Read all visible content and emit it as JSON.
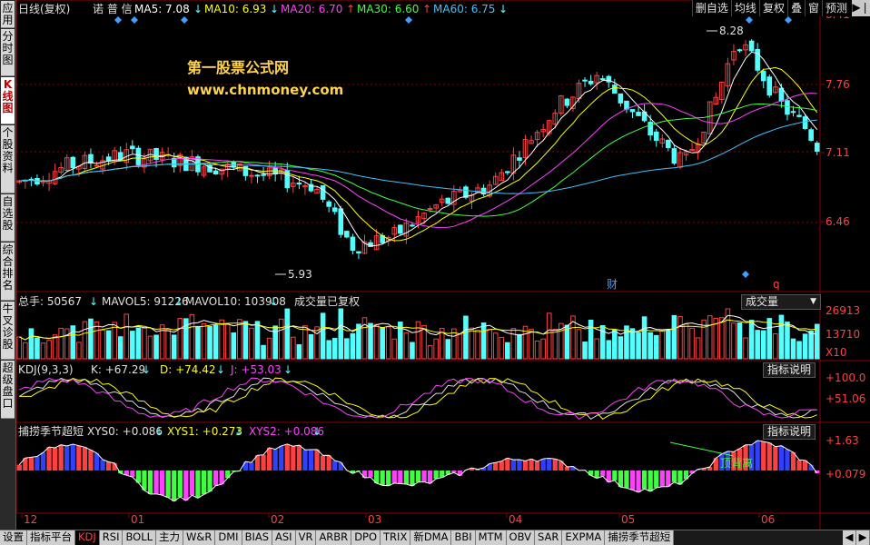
{
  "sidebar": {
    "items": [
      {
        "label": "应用",
        "active": false
      },
      {
        "label": "分时图",
        "active": false
      },
      {
        "label": "K线图",
        "active": true
      },
      {
        "label": "个股资料",
        "active": false
      },
      {
        "label": "自选股",
        "active": false
      },
      {
        "label": "综合排名",
        "active": false
      },
      {
        "label": "牛叉诊股",
        "active": false
      },
      {
        "label": "超级盘口",
        "active": false
      }
    ]
  },
  "header": {
    "period": "日线(复权)",
    "stock": "诺 普 信",
    "ma": [
      {
        "label": "MA5: 7.08",
        "arrow": "↓",
        "color": "#ffffff"
      },
      {
        "label": "MA10: 6.93",
        "arrow": "↓",
        "color": "#ffff00"
      },
      {
        "label": "MA20: 6.70",
        "arrow": "↑",
        "color": "#ff40ff"
      },
      {
        "label": "MA30: 6.60",
        "arrow": "↑",
        "color": "#40ff40"
      },
      {
        "label": "MA60: 6.75",
        "arrow": "↓",
        "color": "#40c0ff"
      }
    ]
  },
  "toolbar": {
    "items": [
      "删自选",
      "均线",
      "复权",
      "叠",
      "窗",
      "预测"
    ],
    "arrow": "▶❘"
  },
  "watermark": {
    "line1": "第一股票公式网",
    "line2": "www.chnmoney.com"
  },
  "price_axis": {
    "labels": [
      "8.41",
      "7.76",
      "7.11",
      "6.46"
    ],
    "high_mark": "8.28",
    "low_mark": "5.93"
  },
  "markers": {
    "cai": "财",
    "q": "q"
  },
  "volume_panel": {
    "title": "总手: 50567",
    "mavol5": "MAVOL5: 91226",
    "mavol10": "MAVOL10: 103908",
    "note": "成交量已复权",
    "selector": "成交量",
    "axis": [
      "26913",
      "13710",
      "X10"
    ]
  },
  "kdj_panel": {
    "title": "KDJ(9,3,3)",
    "k": "K: +67.29",
    "d": "D: +74.42",
    "j": "J: +53.03",
    "button": "指标说明",
    "axis": [
      "+100.0",
      "+51.06"
    ]
  },
  "custom_panel": {
    "title": "捕捞季节超短",
    "xys0": "XYS0: +0.086",
    "xys1": "XYS1: +0.273",
    "xys2": "XYS2: +0.086",
    "button": "指标说明",
    "axis": [
      "+1.63",
      "+0.079"
    ],
    "annotation": "顶背离"
  },
  "x_axis": {
    "labels": [
      "12",
      "01",
      "02",
      "03",
      "04",
      "05",
      "06"
    ]
  },
  "bottom_tabs": [
    "设置",
    "指标平台",
    "KDJ",
    "RSI",
    "BOLL",
    "主力",
    "W&R",
    "DMI",
    "BIAS",
    "ASI",
    "VR",
    "ARBR",
    "DPO",
    "TRIX",
    "新DMA",
    "BBI",
    "MTM",
    "OBV",
    "SAR",
    "EXPMA",
    "捕捞季节超短"
  ],
  "bottom_active": "KDJ",
  "bottom_nav": [
    "◀",
    "▶"
  ],
  "colors": {
    "up": "#ff4040",
    "down": "#54ffff",
    "ma5": "#ffffff",
    "ma10": "#ffff00",
    "ma20": "#ff40ff",
    "ma30": "#40ff40",
    "ma60": "#40c0ff",
    "grid": "#8b0000",
    "watermark": "#ffd24a"
  },
  "chart_data": {
    "type": "candlestick",
    "price_axis_ticks": [
      8.41,
      7.76,
      7.11,
      6.46
    ],
    "high": 8.28,
    "low": 5.93,
    "ma_latest": {
      "MA5": 7.08,
      "MA10": 6.93,
      "MA20": 6.7,
      "MA30": 6.6,
      "MA60": 6.75
    }
  }
}
